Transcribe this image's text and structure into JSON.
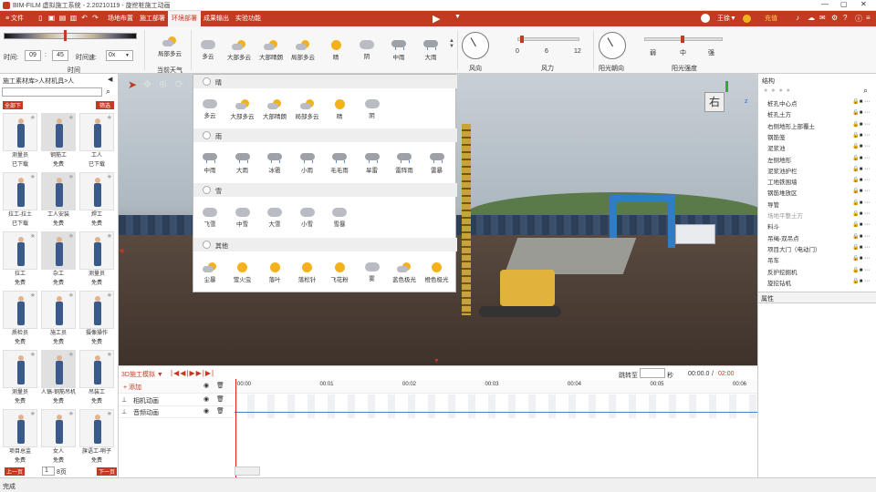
{
  "app": {
    "title": "BIM-FILM 虚拟施工系统 - 2.20210119 - 旋挖桩施工动画"
  },
  "menu": {
    "file": "文件",
    "items": [
      "场地布置",
      "施工部署",
      "环境部署",
      "成果输出",
      "实验功能"
    ],
    "user": "王徐▼",
    "recharge": "充值"
  },
  "ribbon": {
    "time_label": "时间:",
    "hour": "09",
    "minute": "45",
    "speed_label": "时间速:",
    "speed": "0x",
    "time_group": "时间",
    "current_weather_name": "局部多云",
    "current_weather_group": "当前天气",
    "weather_quick": [
      "多云",
      "大部多云",
      "大部晴朗",
      "局部多云",
      "晴",
      "阴",
      "中雨",
      "大雨"
    ],
    "wind_dir_group": "风向",
    "wind_force_ticks": [
      "0",
      "6",
      "12"
    ],
    "wind_force_group": "风力",
    "sun_dir_group": "阳光朝向",
    "sun_strength_ticks": [
      "弱",
      "中",
      "强"
    ],
    "sun_strength_group": "阳光强度"
  },
  "weather_popup": {
    "sections": [
      {
        "title": "晴",
        "items": [
          "多云",
          "大部多云",
          "大部晴朗",
          "局部多云",
          "晴",
          "阴"
        ]
      },
      {
        "title": "雨",
        "items": [
          "中雨",
          "大雨",
          "冰雹",
          "小雨",
          "毛毛雨",
          "旱雷",
          "雷阵雨",
          "雷暴"
        ]
      },
      {
        "title": "雪",
        "items": [
          "飞雪",
          "中雪",
          "大雪",
          "小雪",
          "雪暴"
        ]
      },
      {
        "title": "其他",
        "items": [
          "尘暴",
          "萤火虫",
          "落叶",
          "落松针",
          "飞花粉",
          "雾",
          "蓝色极光",
          "橙色极光"
        ]
      }
    ]
  },
  "left_panel": {
    "breadcrumb": "施工素材库>人材机具>人",
    "tag_all": "全部下载",
    "tag_more": "筛选",
    "cards": [
      {
        "name": "测量员",
        "status": "已下载"
      },
      {
        "name": "钢筋工",
        "status": "免费"
      },
      {
        "name": "工人",
        "status": "已下载"
      },
      {
        "name": "拉工-拉土",
        "status": "已下载"
      },
      {
        "name": "工人安装",
        "status": "免费"
      },
      {
        "name": "焊工",
        "status": "免费"
      },
      {
        "name": "拉工",
        "status": "免费"
      },
      {
        "name": "杂工",
        "status": "免费"
      },
      {
        "name": "测量员",
        "status": "免费"
      },
      {
        "name": "质检员",
        "status": "免费"
      },
      {
        "name": "施工员",
        "status": "免费"
      },
      {
        "name": "摄像操作",
        "status": "免费"
      },
      {
        "name": "测量员",
        "status": "免费"
      },
      {
        "name": "人镐-钢筋吊机",
        "status": "免费"
      },
      {
        "name": "吊装工",
        "status": "免费"
      },
      {
        "name": "项目总监",
        "status": "免费"
      },
      {
        "name": "女人",
        "status": "免费"
      },
      {
        "name": "旗语工-哨子",
        "status": "免费"
      }
    ],
    "prev": "上一页",
    "page": "1",
    "page_total": "8页",
    "next": "下一页"
  },
  "viewport": {
    "compass_label": "右"
  },
  "timeline": {
    "mode": "3D施工模拟 ▼",
    "add": "+ 添加",
    "jump_label": "跳转至",
    "jump_unit": "秒",
    "current_time": "00:00.0",
    "total_time": "02:00",
    "ticks": [
      "00:00",
      "00:01",
      "00:02",
      "00:03",
      "00:04",
      "00:05",
      "00:06"
    ],
    "tracks": [
      "相机动画",
      "音频动画"
    ]
  },
  "right_panel": {
    "title": "结构",
    "items": [
      "桩孔中心点",
      "桩孔土方",
      "右侧地形上部覆土",
      "钢筋笼",
      "泥浆池",
      "左侧地形",
      "泥浆池护栏",
      "工地铁围墙",
      "钢筋堆放区",
      "导管",
      "场地平整土方",
      "料斗",
      "吊绳-双吊点",
      "项目大门（电动门）",
      "吊车",
      "反护挖掘机",
      "旋挖钻机"
    ],
    "properties": "属性"
  },
  "status": {
    "text": "完成"
  },
  "colors": {
    "accent": "#c23a22",
    "sun": "#f3b21c",
    "cloud": "#b9bcc2"
  }
}
